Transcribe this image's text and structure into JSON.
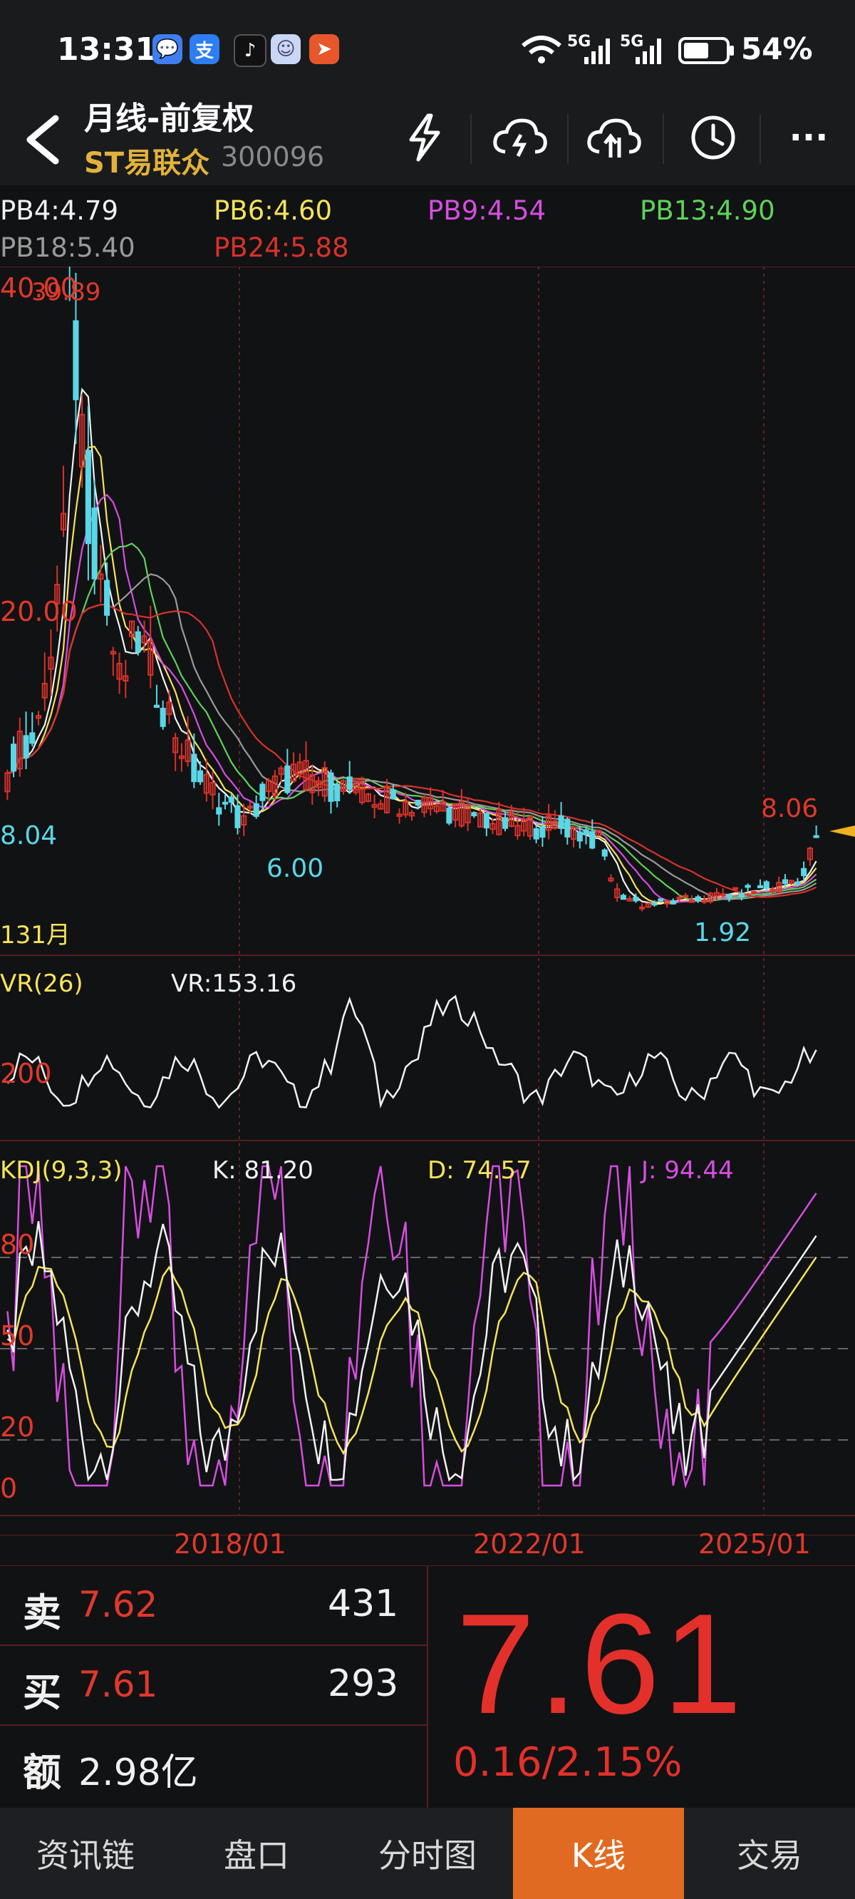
{
  "status": {
    "time": "13:31",
    "battery": "54%",
    "signal1": "5G",
    "signal2": "5G",
    "apps": [
      "msg-icon",
      "alipay-icon",
      "tiktok-icon",
      "bot-icon",
      "send-icon"
    ],
    "app_glyphs": [
      "💬",
      "支",
      "♪",
      "☺",
      "➤"
    ]
  },
  "header": {
    "title": "月线-前复权",
    "stock_name": "ST易联众",
    "stock_code": "300096",
    "tools": [
      "flash-icon",
      "cloud-download-icon",
      "cloud-upload-icon",
      "history-icon",
      "more-icon"
    ],
    "more_label": "···"
  },
  "ma": {
    "items": [
      {
        "text": "PB4:4.79",
        "color": "#f2f2f2"
      },
      {
        "text": "PB6:4.60",
        "color": "#f5e35a"
      },
      {
        "text": "PB9:4.54",
        "color": "#d64ee0"
      },
      {
        "text": "PB13:4.90",
        "color": "#5ed25a"
      },
      {
        "text": "PB18:5.40",
        "color": "#9a9a9a"
      },
      {
        "text": "PB24:5.88",
        "color": "#d8322a"
      }
    ]
  },
  "kline": {
    "y_top_label": "40.00",
    "y_top_overlap": "39.89",
    "y_mid_label": "20.00",
    "low_left": "8.04",
    "low_mid": "6.00",
    "low_right": "1.92",
    "last_high": "8.06",
    "period_count": "131月"
  },
  "vr": {
    "name": "VR(26)",
    "value": "VR:153.16",
    "level": "200"
  },
  "kdj": {
    "name": "KDJ(9,3,3)",
    "k": "K: 81.20",
    "d": "D: 74.57",
    "j": "J: 94.44",
    "levels": [
      "80",
      "50",
      "20",
      "0"
    ]
  },
  "xaxis": {
    "dates": [
      "2018/01",
      "2022/01",
      "2025/01"
    ]
  },
  "quote": {
    "sell_label": "卖",
    "sell_price": "7.62",
    "sell_vol": "431",
    "buy_label": "买",
    "buy_price": "7.61",
    "buy_vol": "293",
    "amount_label": "额",
    "amount": "2.98亿",
    "last_price": "7.61",
    "change": "0.16/2.15%"
  },
  "tabs": [
    {
      "label": "资讯链",
      "active": false
    },
    {
      "label": "盘口",
      "active": false
    },
    {
      "label": "分时图",
      "active": false
    },
    {
      "label": "K线",
      "active": true
    },
    {
      "label": "交易",
      "active": false
    }
  ],
  "colors": {
    "up": "#d8322a",
    "down": "#5ad7e6",
    "accent": "#e06a22"
  }
}
